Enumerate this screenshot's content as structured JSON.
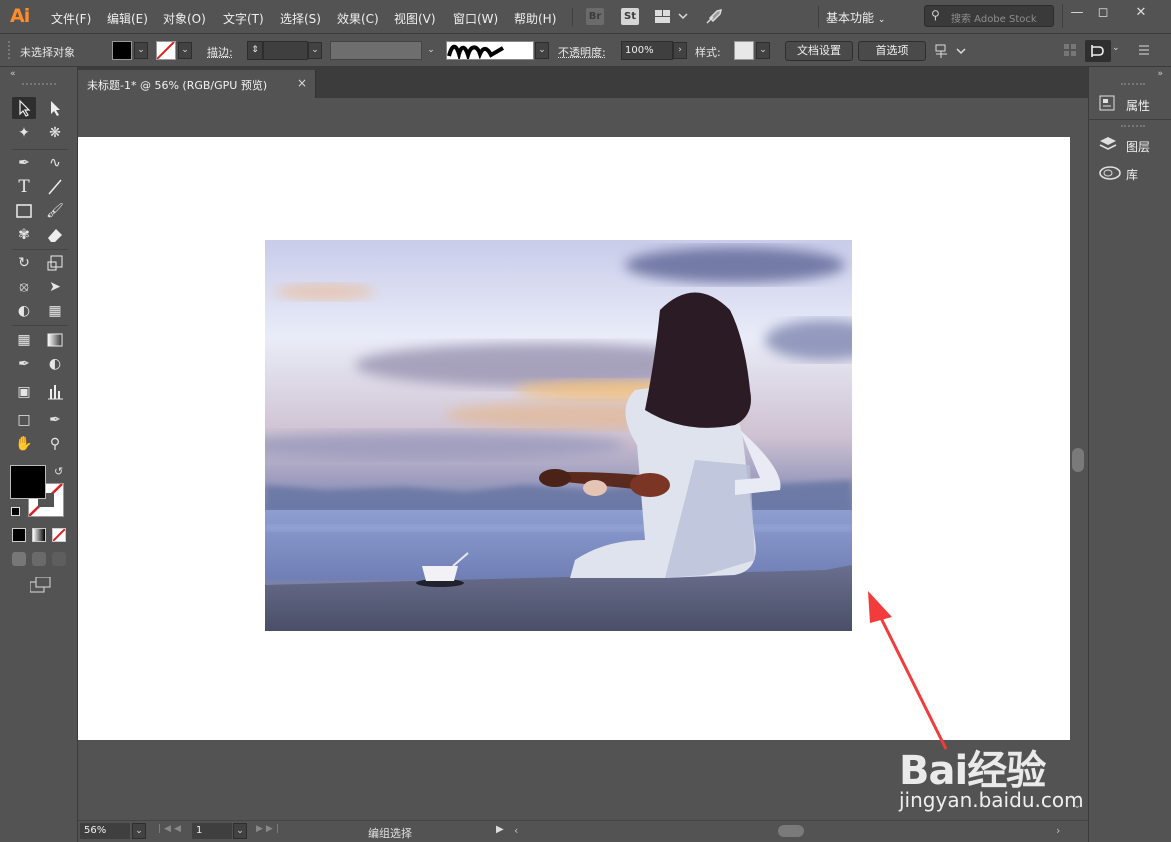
{
  "app": {
    "logo": "Ai",
    "menus": [
      "文件(F)",
      "编辑(E)",
      "对象(O)",
      "文字(T)",
      "选择(S)",
      "效果(C)",
      "视图(V)",
      "窗口(W)",
      "帮助(H)"
    ],
    "bridge_label": "Br",
    "stock_label": "St",
    "workspace": "基本功能",
    "search_placeholder": "搜索 Adobe Stock",
    "accent": "#ff8c2a"
  },
  "control": {
    "selection_status": "未选择对象",
    "stroke_label": "描边",
    "opacity_label": "不透明度",
    "opacity_value": "100%",
    "style_label": "样式",
    "doc_setup_button": "文档设置",
    "prefs_button": "首选项"
  },
  "document": {
    "tab_title": "未标题-1* @ 56% (RGB/GPU 预览)",
    "close_glyph": "×"
  },
  "status": {
    "zoom": "56%",
    "page": "1",
    "mode": "编组选择"
  },
  "panels": [
    {
      "label": "属性",
      "icon": "properties-icon"
    },
    {
      "label": "图层",
      "icon": "layers-icon"
    },
    {
      "label": "库",
      "icon": "libraries-icon"
    }
  ],
  "watermark": {
    "brand": "Bai经验",
    "url": "jingyan.baidu.com"
  }
}
